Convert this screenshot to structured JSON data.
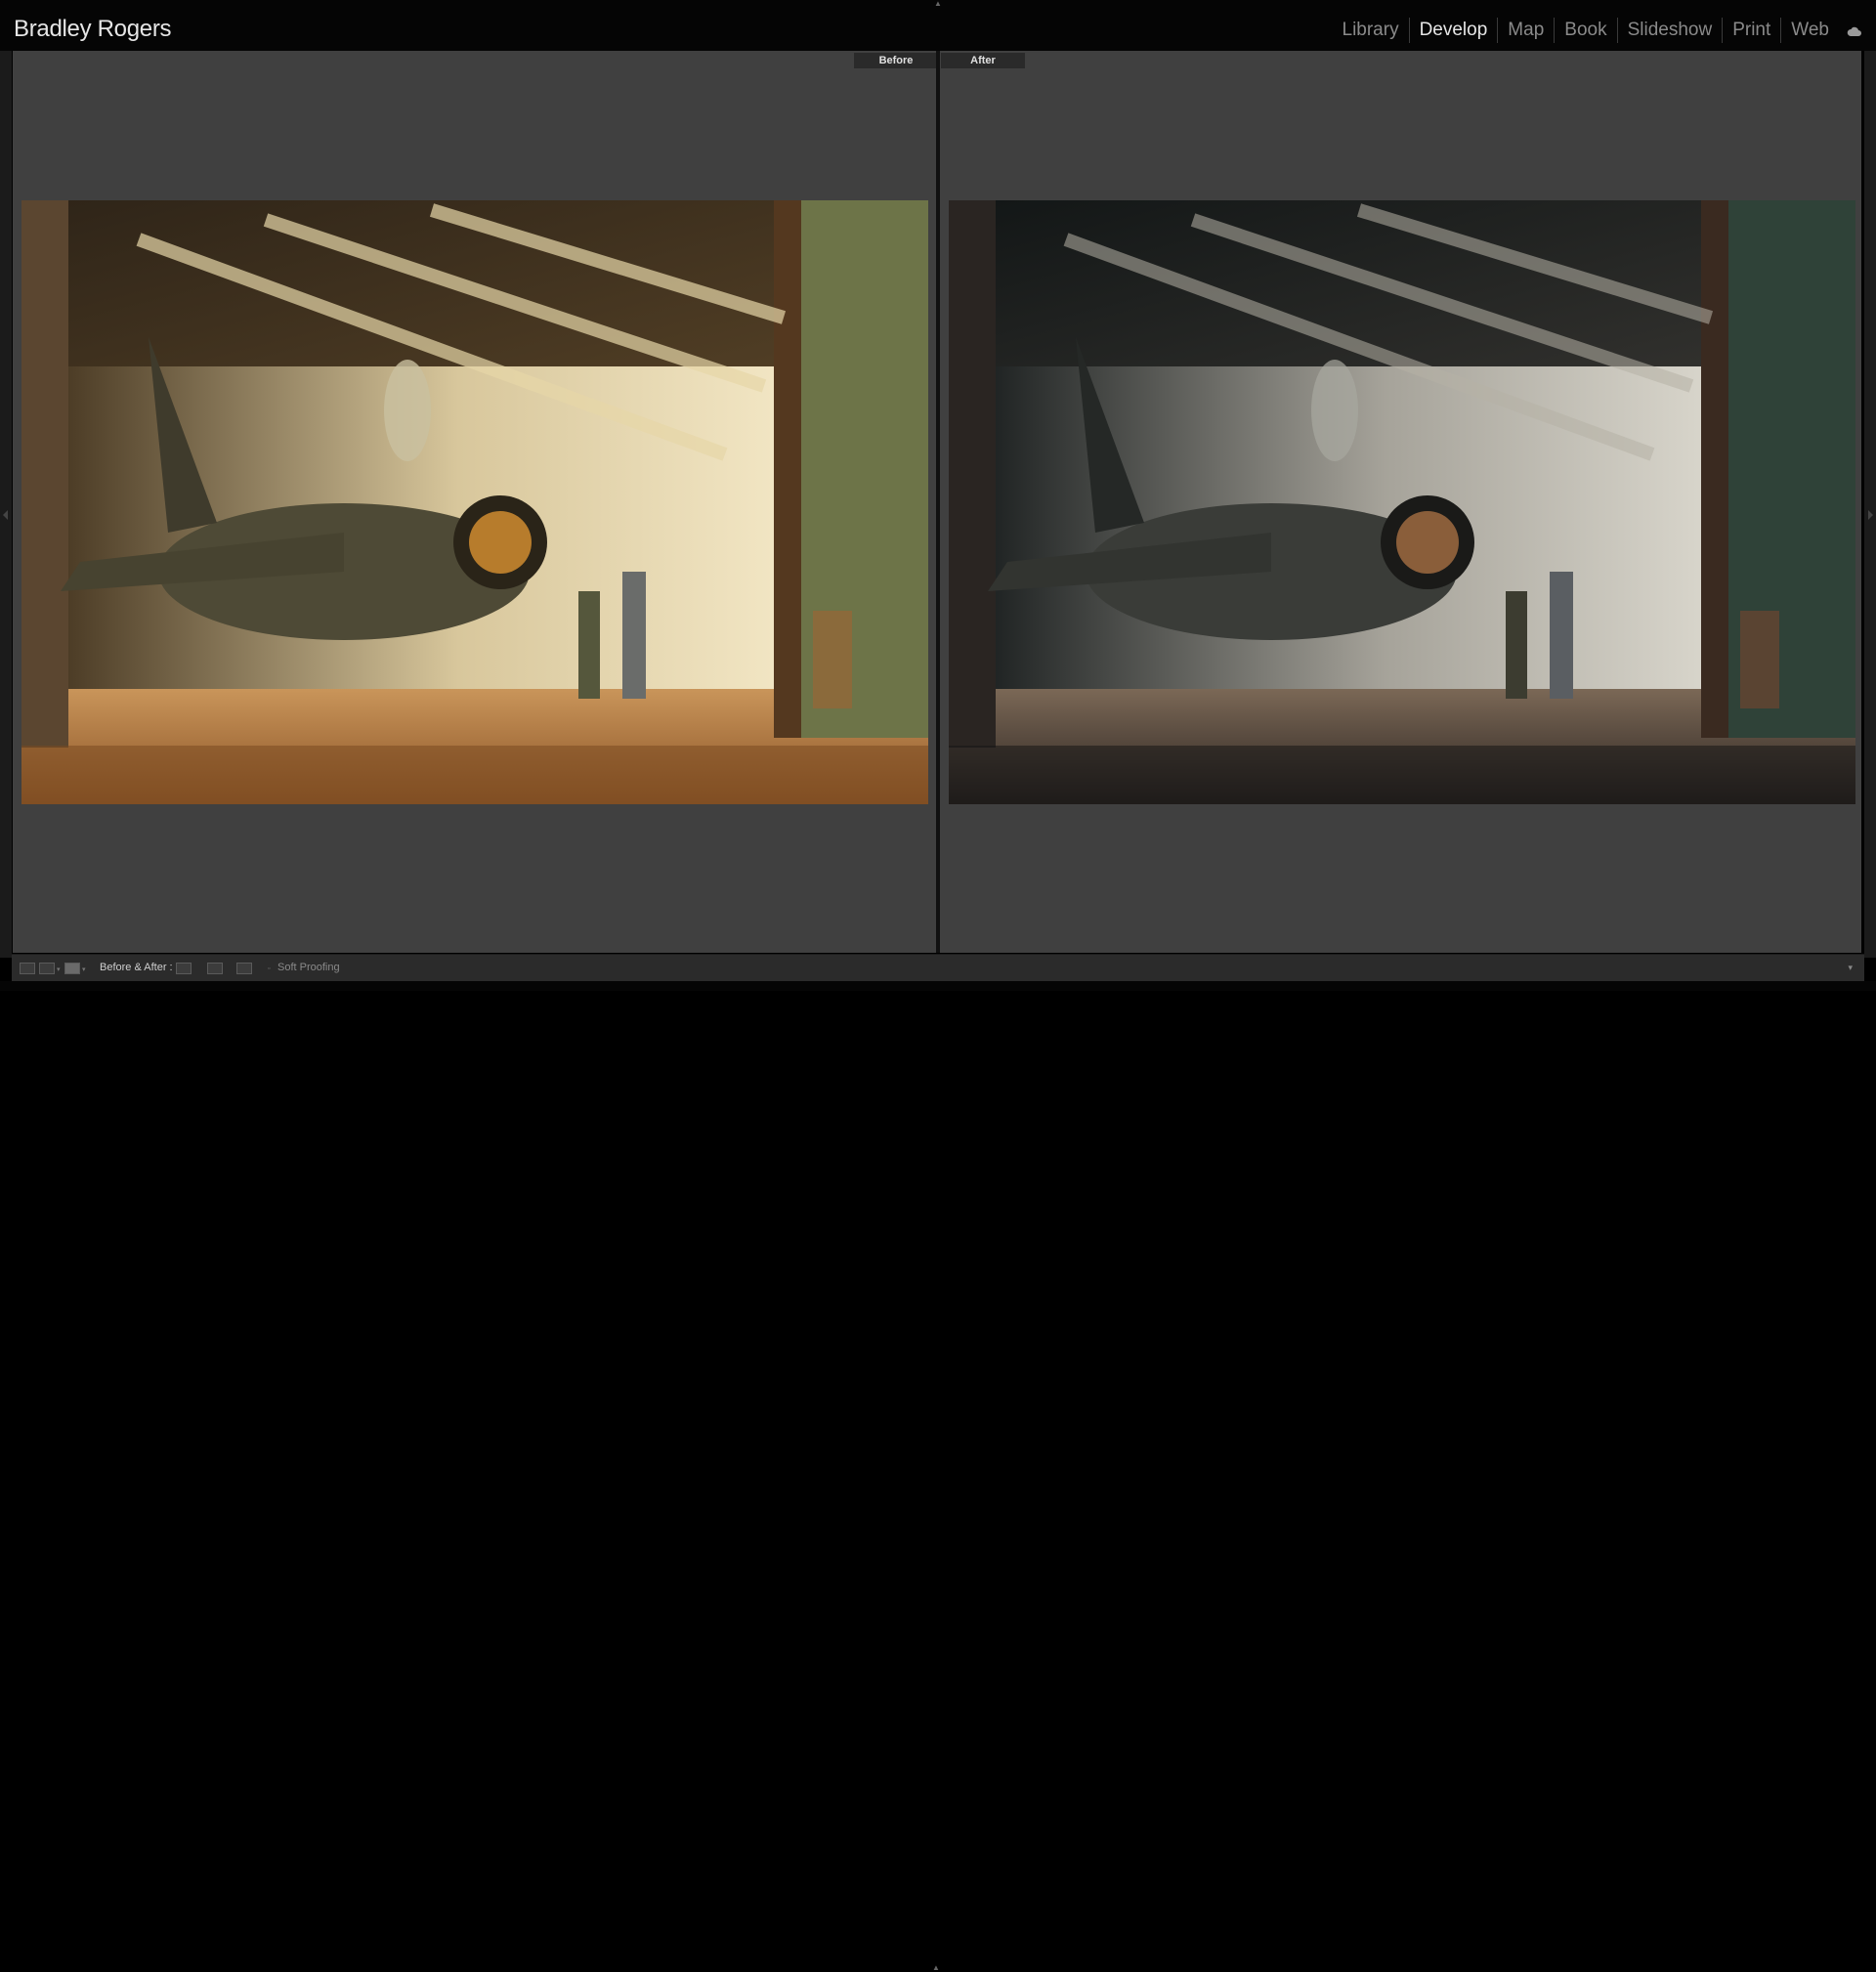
{
  "identity_plate": "Bradley Rogers",
  "modules": [
    {
      "label": "Library",
      "active": false
    },
    {
      "label": "Develop",
      "active": true
    },
    {
      "label": "Map",
      "active": false
    },
    {
      "label": "Book",
      "active": false
    },
    {
      "label": "Slideshow",
      "active": false
    },
    {
      "label": "Print",
      "active": false
    },
    {
      "label": "Web",
      "active": false
    }
  ],
  "compare": {
    "before_label": "Before",
    "after_label": "After"
  },
  "toolbar": {
    "before_after_label": "Before & After :",
    "soft_proofing_label": "Soft Proofing"
  },
  "colors": {
    "active_module": "#e6e6e6",
    "inactive_module": "#8a8a8a",
    "canvas_background": "#404040",
    "label_background": "#2a2a2a"
  },
  "icons": [
    "cloud-sync-icon",
    "loupe-view-icon",
    "grid-view-icon",
    "compare-view-icon",
    "swap-settings-icon",
    "copy-settings-icon",
    "swap-images-icon"
  ]
}
